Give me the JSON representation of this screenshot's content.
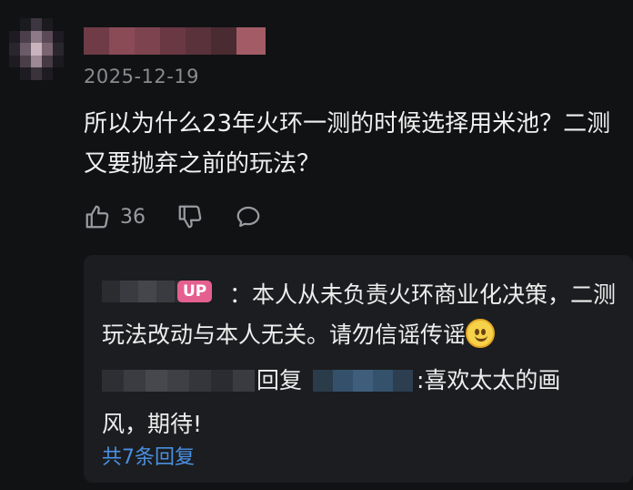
{
  "comment": {
    "date": "2025-12-19",
    "text": "所以为什么23年火环一测的时候选择用米池？二测又要抛弃之前的玩法？",
    "like_count": "36",
    "icons": [
      "thumbs-up-icon",
      "thumbs-down-icon",
      "reply-bubble-icon"
    ]
  },
  "replies": {
    "items": [
      {
        "badge": "UP",
        "separator": "：",
        "text_a": "本人从未负责火环商业化决策，",
        "text_b": "二测玩法改动与本人无关。请勿信谣传谣",
        "emoji": "smile-emoji"
      },
      {
        "reply_word": "回复",
        "text_line1": ":喜欢太太的画",
        "text_line2": "风，期待!"
      }
    ],
    "view_more": "共7条回复"
  },
  "colors": {
    "background": "#111214",
    "reply_box": "#1c1d20",
    "up_badge": "#e5608f",
    "link_blue": "#4a90e2",
    "muted_text": "#8a8a8f"
  }
}
